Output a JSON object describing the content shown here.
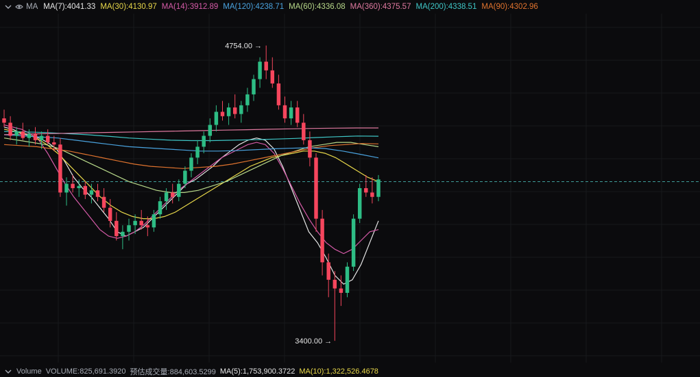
{
  "legend": {
    "collapse_icon": "chevron-down-icon",
    "toggle_icon": "eye-icon",
    "label": "MA",
    "items": [
      {
        "text": "MA(7):4041.33",
        "color": "#e6e6e6"
      },
      {
        "text": "MA(30):4130.97",
        "color": "#e8d84a"
      },
      {
        "text": "MA(14):3912.89",
        "color": "#d65ba8"
      },
      {
        "text": "MA(120):4238.71",
        "color": "#4aa3df"
      },
      {
        "text": "MA(60):4336.08",
        "color": "#b8d98a"
      },
      {
        "text": "MA(360):4375.57",
        "color": "#e07aa0"
      },
      {
        "text": "MA(200):4338.51",
        "color": "#3fc7c7"
      },
      {
        "text": "MA(90):4302.96",
        "color": "#e0732e"
      }
    ]
  },
  "annotations": {
    "high": "4754.00",
    "low": "3400.00"
  },
  "volume": {
    "collapse_icon": "chevron-down-icon",
    "label": "Volume",
    "volume_text": "VOLUME:825,691.3920",
    "est_text": "预估成交量:884,603.5299",
    "ma5_text": "MA(5):1,753,900.3722",
    "ma10_text": "MA(10):1,322,526.4678",
    "colors": {
      "label": "#a8adb6",
      "ma5": "#e6e6e6",
      "ma10": "#e8d84a"
    }
  },
  "chart_data": {
    "type": "candlestick",
    "ylim": [
      3300,
      4900
    ],
    "current_price_line": 4130,
    "high": 4754.0,
    "low": 3400.0,
    "candles": [
      [
        4420,
        4460,
        4380,
        4400
      ],
      [
        4400,
        4430,
        4320,
        4340
      ],
      [
        4340,
        4380,
        4300,
        4360
      ],
      [
        4360,
        4400,
        4320,
        4330
      ],
      [
        4330,
        4370,
        4290,
        4350
      ],
      [
        4350,
        4380,
        4300,
        4320
      ],
      [
        4320,
        4360,
        4280,
        4340
      ],
      [
        4340,
        4370,
        4300,
        4310
      ],
      [
        4310,
        4340,
        4270,
        4300
      ],
      [
        4300,
        4330,
        4060,
        4080
      ],
      [
        4080,
        4150,
        4020,
        4120
      ],
      [
        4120,
        4160,
        4080,
        4100
      ],
      [
        4100,
        4140,
        4060,
        4110
      ],
      [
        4110,
        4130,
        4050,
        4070
      ],
      [
        4070,
        4120,
        4030,
        4090
      ],
      [
        4090,
        4120,
        4040,
        4060
      ],
      [
        4060,
        4100,
        3990,
        4010
      ],
      [
        4010,
        4050,
        3920,
        3950
      ],
      [
        3950,
        3990,
        3860,
        3880
      ],
      [
        3880,
        3930,
        3820,
        3900
      ],
      [
        3900,
        3960,
        3860,
        3930
      ],
      [
        3930,
        3980,
        3890,
        3950
      ],
      [
        3950,
        4000,
        3910,
        3930
      ],
      [
        3930,
        3970,
        3880,
        3920
      ],
      [
        3920,
        4000,
        3900,
        3980
      ],
      [
        3980,
        4060,
        3960,
        4040
      ],
      [
        4040,
        4100,
        4000,
        4080
      ],
      [
        4080,
        4120,
        4030,
        4060
      ],
      [
        4060,
        4140,
        4040,
        4120
      ],
      [
        4120,
        4200,
        4100,
        4180
      ],
      [
        4180,
        4260,
        4150,
        4240
      ],
      [
        4240,
        4320,
        4210,
        4290
      ],
      [
        4290,
        4360,
        4260,
        4340
      ],
      [
        4340,
        4420,
        4310,
        4390
      ],
      [
        4390,
        4480,
        4360,
        4450
      ],
      [
        4450,
        4500,
        4410,
        4430
      ],
      [
        4430,
        4490,
        4390,
        4470
      ],
      [
        4470,
        4530,
        4420,
        4440
      ],
      [
        4440,
        4500,
        4400,
        4480
      ],
      [
        4480,
        4560,
        4450,
        4530
      ],
      [
        4530,
        4620,
        4500,
        4600
      ],
      [
        4600,
        4700,
        4560,
        4680
      ],
      [
        4680,
        4754,
        4600,
        4640
      ],
      [
        4640,
        4700,
        4560,
        4580
      ],
      [
        4580,
        4620,
        4460,
        4480
      ],
      [
        4480,
        4520,
        4400,
        4420
      ],
      [
        4420,
        4500,
        4390,
        4470
      ],
      [
        4470,
        4500,
        4380,
        4400
      ],
      [
        4400,
        4440,
        4300,
        4320
      ],
      [
        4320,
        4360,
        4200,
        4240
      ],
      [
        4240,
        4260,
        3900,
        3960
      ],
      [
        3960,
        4000,
        3700,
        3760
      ],
      [
        3760,
        3800,
        3600,
        3680
      ],
      [
        3680,
        3720,
        3400,
        3640
      ],
      [
        3640,
        3700,
        3560,
        3620
      ],
      [
        3620,
        3760,
        3600,
        3740
      ],
      [
        3740,
        3980,
        3720,
        3960
      ],
      [
        3960,
        4120,
        3940,
        4100
      ],
      [
        4100,
        4160,
        4060,
        4080
      ],
      [
        4080,
        4150,
        4030,
        4060
      ],
      [
        4060,
        4160,
        4040,
        4140
      ]
    ],
    "ma_lines": [
      {
        "name": "MA(7)",
        "color": "#e6e6e6",
        "values": [
          4380,
          4370,
          4350,
          4340,
          4330,
          4310,
          4280,
          4220,
          4150,
          4100,
          4060,
          4010,
          3960,
          3900,
          3880,
          3900,
          3920,
          3960,
          4000,
          4040,
          4080,
          4120,
          4140,
          4170,
          4200,
          4240,
          4270,
          4300,
          4320,
          4330,
          4320,
          4280,
          4200,
          4100,
          4000,
          3900,
          3850,
          3780,
          3700,
          3660,
          3680,
          3750,
          3850,
          3950
        ]
      },
      {
        "name": "MA(14)",
        "color": "#d65ba8",
        "values": [
          4390,
          4380,
          4370,
          4350,
          4320,
          4260,
          4190,
          4120,
          4060,
          4010,
          3960,
          3910,
          3880,
          3870,
          3880,
          3900,
          3930,
          3970,
          4010,
          4050,
          4090,
          4120,
          4150,
          4180,
          4210,
          4240,
          4260,
          4280,
          4300,
          4310,
          4300,
          4260,
          4190,
          4110,
          4030,
          3960,
          3900,
          3850,
          3820,
          3800,
          3820,
          3860,
          3900,
          3910
        ]
      },
      {
        "name": "MA(30)",
        "color": "#e8d84a",
        "values": [
          4370,
          4360,
          4350,
          4330,
          4300,
          4260,
          4210,
          4160,
          4110,
          4060,
          4020,
          3990,
          3970,
          3960,
          3960,
          3970,
          3990,
          4020,
          4050,
          4080,
          4110,
          4140,
          4170,
          4200,
          4220,
          4240,
          4250,
          4260,
          4270,
          4270,
          4260,
          4240,
          4210,
          4180,
          4150,
          4130
        ]
      },
      {
        "name": "MA(60)",
        "color": "#b8d98a",
        "values": [
          4330,
          4320,
          4310,
          4300,
          4280,
          4250,
          4220,
          4190,
          4160,
          4130,
          4110,
          4090,
          4080,
          4080,
          4090,
          4110,
          4130,
          4160,
          4190,
          4220,
          4250,
          4270,
          4290,
          4300,
          4310,
          4310,
          4300,
          4290
        ]
      },
      {
        "name": "MA(90)",
        "color": "#e0732e",
        "values": [
          4300,
          4295,
          4290,
          4280,
          4270,
          4255,
          4240,
          4225,
          4210,
          4200,
          4195,
          4190,
          4195,
          4200,
          4210,
          4225,
          4240,
          4255,
          4270,
          4285,
          4295,
          4300,
          4305,
          4303
        ]
      },
      {
        "name": "MA(120)",
        "color": "#4aa3df",
        "values": [
          4345,
          4340,
          4335,
          4330,
          4320,
          4310,
          4300,
          4290,
          4285,
          4280,
          4275,
          4270,
          4270,
          4272,
          4276,
          4280,
          4283,
          4285,
          4282,
          4270,
          4255,
          4239
        ]
      },
      {
        "name": "MA(200)",
        "color": "#3fc7c7",
        "values": [
          4360,
          4358,
          4355,
          4350,
          4345,
          4338,
          4330,
          4325,
          4320,
          4318,
          4318,
          4320,
          4322,
          4325,
          4328,
          4332,
          4336,
          4339,
          4338
        ]
      },
      {
        "name": "MA(360)",
        "color": "#e07aa0",
        "values": [
          4345,
          4348,
          4350,
          4352,
          4354,
          4356,
          4358,
          4360,
          4362,
          4364,
          4366,
          4368,
          4370,
          4372,
          4374,
          4375,
          4376,
          4376
        ]
      }
    ]
  }
}
